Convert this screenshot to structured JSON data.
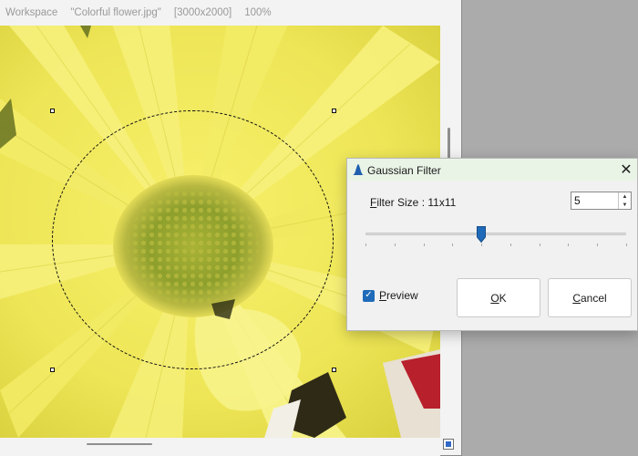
{
  "workspace": {
    "title": "Workspace",
    "file_name": "\"Colorful flower.jpg\"",
    "dimensions": "[3000x2000]",
    "zoom": "100%"
  },
  "dialog": {
    "title": "Gaussian Filter",
    "icon": "gaussian-bell-icon",
    "close_glyph": "✕",
    "filter_size_label_mnemonic": "F",
    "filter_size_label_rest": "ilter Size : 11x11",
    "filter_size_value": "5",
    "slider": {
      "min": 1,
      "max": 10,
      "value": 5
    },
    "preview_checked": true,
    "preview_label_mnemonic": "P",
    "preview_label_rest": "review",
    "ok_mnemonic": "O",
    "ok_rest": "K",
    "cancel_mnemonic": "C",
    "cancel_rest": "ancel"
  },
  "colors": {
    "accent": "#1f6bb9",
    "dialog_title_bg": "#e9f4e6",
    "petal_yellow": "#f1ec5a",
    "flower_center": "#8fa62e"
  }
}
